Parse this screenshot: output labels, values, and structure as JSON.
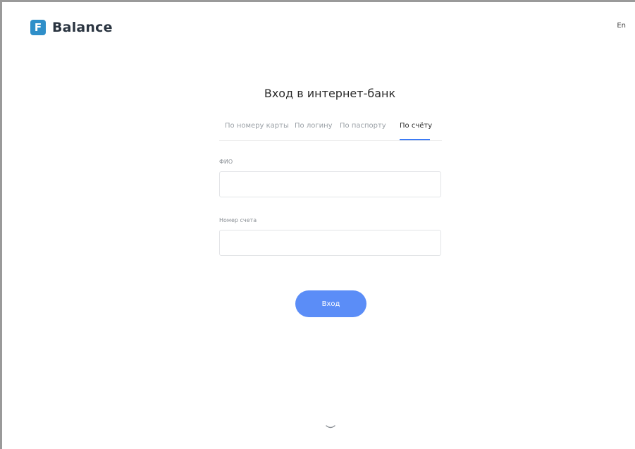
{
  "header": {
    "logo_letter": "F",
    "brand": "Balance",
    "language_switch": "En"
  },
  "login": {
    "title": "Вход в интернет-банк",
    "tabs": [
      {
        "label": "По номеру карты",
        "active": false
      },
      {
        "label": "По логину",
        "active": false
      },
      {
        "label": "По паспорту",
        "active": false
      },
      {
        "label": "По счёту",
        "active": true
      }
    ],
    "fields": {
      "name_label": "ФИО",
      "name_value": "",
      "account_label": "Номер счета",
      "account_value": ""
    },
    "submit_label": "Вход"
  },
  "colors": {
    "accent": "#5b8df7",
    "tab_underline": "#3d7bf5",
    "logo": "#2f8fc9"
  },
  "icons": {
    "scroll_down": "chevron-down-icon"
  }
}
